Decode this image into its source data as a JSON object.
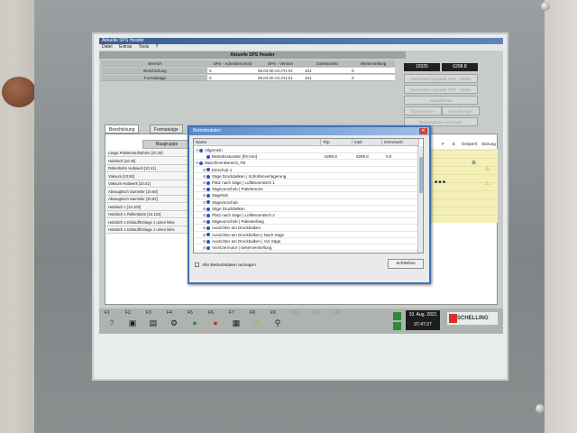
{
  "window": {
    "title": "Aktuelle SPS Header"
  },
  "menu": [
    "Datei",
    "Extras",
    "Tools",
    "?"
  ],
  "header": {
    "title": "Aktuelle SPS Header",
    "rows": [
      {
        "label": "Bereich",
        "cells": [
          "SPS - Adressbit (Inst)",
          "SPS - Version",
          "Dateischnitt",
          "Weiterstellung"
        ]
      },
      {
        "label": "Beschickung",
        "cells": [
          "0",
          "05.04.00.AC.FH.01",
          "101",
          "0"
        ]
      },
      {
        "label": "Formatsäge",
        "cells": [
          "0",
          "05.04.00.AC.FH.01",
          "101",
          "0"
        ]
      }
    ],
    "counters": [
      "18325",
      "6298.8"
    ],
    "side_buttons": [
      "Datenbank Upgrade SPS - Weiter",
      "Datenbank Upgrade SPS - Weiter",
      "Aktualisieren",
      "Aktualisierungsdatei",
      "Betriebsdaten anzeigen"
    ],
    "small_buttons": [
      "Übernehmen",
      "Einstellungen"
    ]
  },
  "tabs": [
    "Beschickung",
    "Formatsäge"
  ],
  "group_table": {
    "header": "Baugruppe",
    "rows": [
      "Längs Palettenaufnahme [10.20]",
      "Hubtisch [10.40]",
      "Rollenbahn Hubwerk [10.41]",
      "Vakuum [10.50]",
      "Vakuum Hubwerk [10.51]",
      "Absaugtisch Sammler [10.60]",
      "Absaugtisch Sammler [10.62]",
      "Hubtisch 1 [10.100]",
      "Hubtisch 1 Rollenbahn [10.102]",
      "Hubtisch 1 Einlauf/Einlage 1 unten links",
      "Hubtisch 1 Einlauf/Einlage 1 unten links"
    ],
    "right_headers": [
      "F",
      "E",
      "Gesperrt",
      "Störung"
    ]
  },
  "dialog": {
    "title": "Betriebsdaten",
    "close_glyph": "✕",
    "columns": [
      "Name",
      "Trip",
      "total",
      "Grenzwert"
    ],
    "rows": [
      {
        "level": 0,
        "exp": "⊟",
        "name": "Allgemein",
        "trip": "",
        "total": "",
        "limit": ""
      },
      {
        "level": 1,
        "exp": "",
        "name": "Betriebsstunden [hh:mm]",
        "trip": "6298.8",
        "total": "6298.8",
        "limit": "0.0"
      },
      {
        "level": 0,
        "exp": "⊟",
        "name": "MaschinenBereich_FB",
        "trip": "",
        "total": "",
        "limit": ""
      },
      {
        "level": 1,
        "exp": "⊞",
        "name": "Einschub 1",
        "trip": "",
        "total": "",
        "limit": ""
      },
      {
        "level": 1,
        "exp": "⊞",
        "name": "Säge Druckbalken | Schürfenverlagerung",
        "trip": "",
        "total": "",
        "limit": ""
      },
      {
        "level": 1,
        "exp": "⊞",
        "name": "Platz nach Säge | Luftkissentisch 1",
        "trip": "",
        "total": "",
        "limit": ""
      },
      {
        "level": 1,
        "exp": "⊞",
        "name": "Sägevorschub | Pakettrenne",
        "trip": "",
        "total": "",
        "limit": ""
      },
      {
        "level": 1,
        "exp": "⊞",
        "name": "Sägehub",
        "trip": "",
        "total": "",
        "limit": ""
      },
      {
        "level": 1,
        "exp": "⊞",
        "name": "Sägevorschub",
        "trip": "",
        "total": "",
        "limit": ""
      },
      {
        "level": 1,
        "exp": "⊞",
        "name": "Säge Druckbalken",
        "trip": "",
        "total": "",
        "limit": ""
      },
      {
        "level": 1,
        "exp": "⊞",
        "name": "Platz nach Säge | Luftkissentisch 2",
        "trip": "",
        "total": "",
        "limit": ""
      },
      {
        "level": 1,
        "exp": "⊞",
        "name": "Sägevorschub | Paketanfang",
        "trip": "",
        "total": "",
        "limit": ""
      },
      {
        "level": 1,
        "exp": "⊞",
        "name": "Ausrichter am Druckbalken",
        "trip": "",
        "total": "",
        "limit": ""
      },
      {
        "level": 1,
        "exp": "⊞",
        "name": "Ausrichter am Druckbalken | Nach Säge",
        "trip": "",
        "total": "",
        "limit": ""
      },
      {
        "level": 1,
        "exp": "⊞",
        "name": "Ausrichter am Druckbalken | Vor Säge",
        "trip": "",
        "total": "",
        "limit": ""
      },
      {
        "level": 1,
        "exp": "⊞",
        "name": "Vorritzermotor | Seitenverstellung",
        "trip": "",
        "total": "",
        "limit": ""
      },
      {
        "level": 1,
        "exp": "⊞",
        "name": "Vorritzermotor | Höhenverstellung",
        "trip": "",
        "total": "",
        "limit": ""
      }
    ],
    "checkbox_label": "Alle Betriebsdaten anzeigen",
    "close_button": "Schließen"
  },
  "function_keys": [
    {
      "label": "F1",
      "icon": "?"
    },
    {
      "label": "F2",
      "icon": "▣"
    },
    {
      "label": "F3",
      "icon": "▤"
    },
    {
      "label": "F4",
      "icon": "⚙"
    },
    {
      "label": "F5",
      "icon": "●"
    },
    {
      "label": "F6",
      "icon": "●"
    },
    {
      "label": "F7",
      "icon": "▦"
    },
    {
      "label": "F8",
      "icon": "⚠"
    },
    {
      "label": "F9",
      "icon": "⚲"
    },
    {
      "label": "F10",
      "icon": ""
    },
    {
      "label": "F11",
      "icon": ""
    },
    {
      "label": "F12",
      "icon": ""
    }
  ],
  "datetime": {
    "date": "10. Aug. 2021",
    "time": "07:47:27"
  },
  "brand": "SCHELLING",
  "colors": {
    "accent": "#3f72b4",
    "brand_red": "#d2342c",
    "ok_green": "#2d8a3a"
  }
}
